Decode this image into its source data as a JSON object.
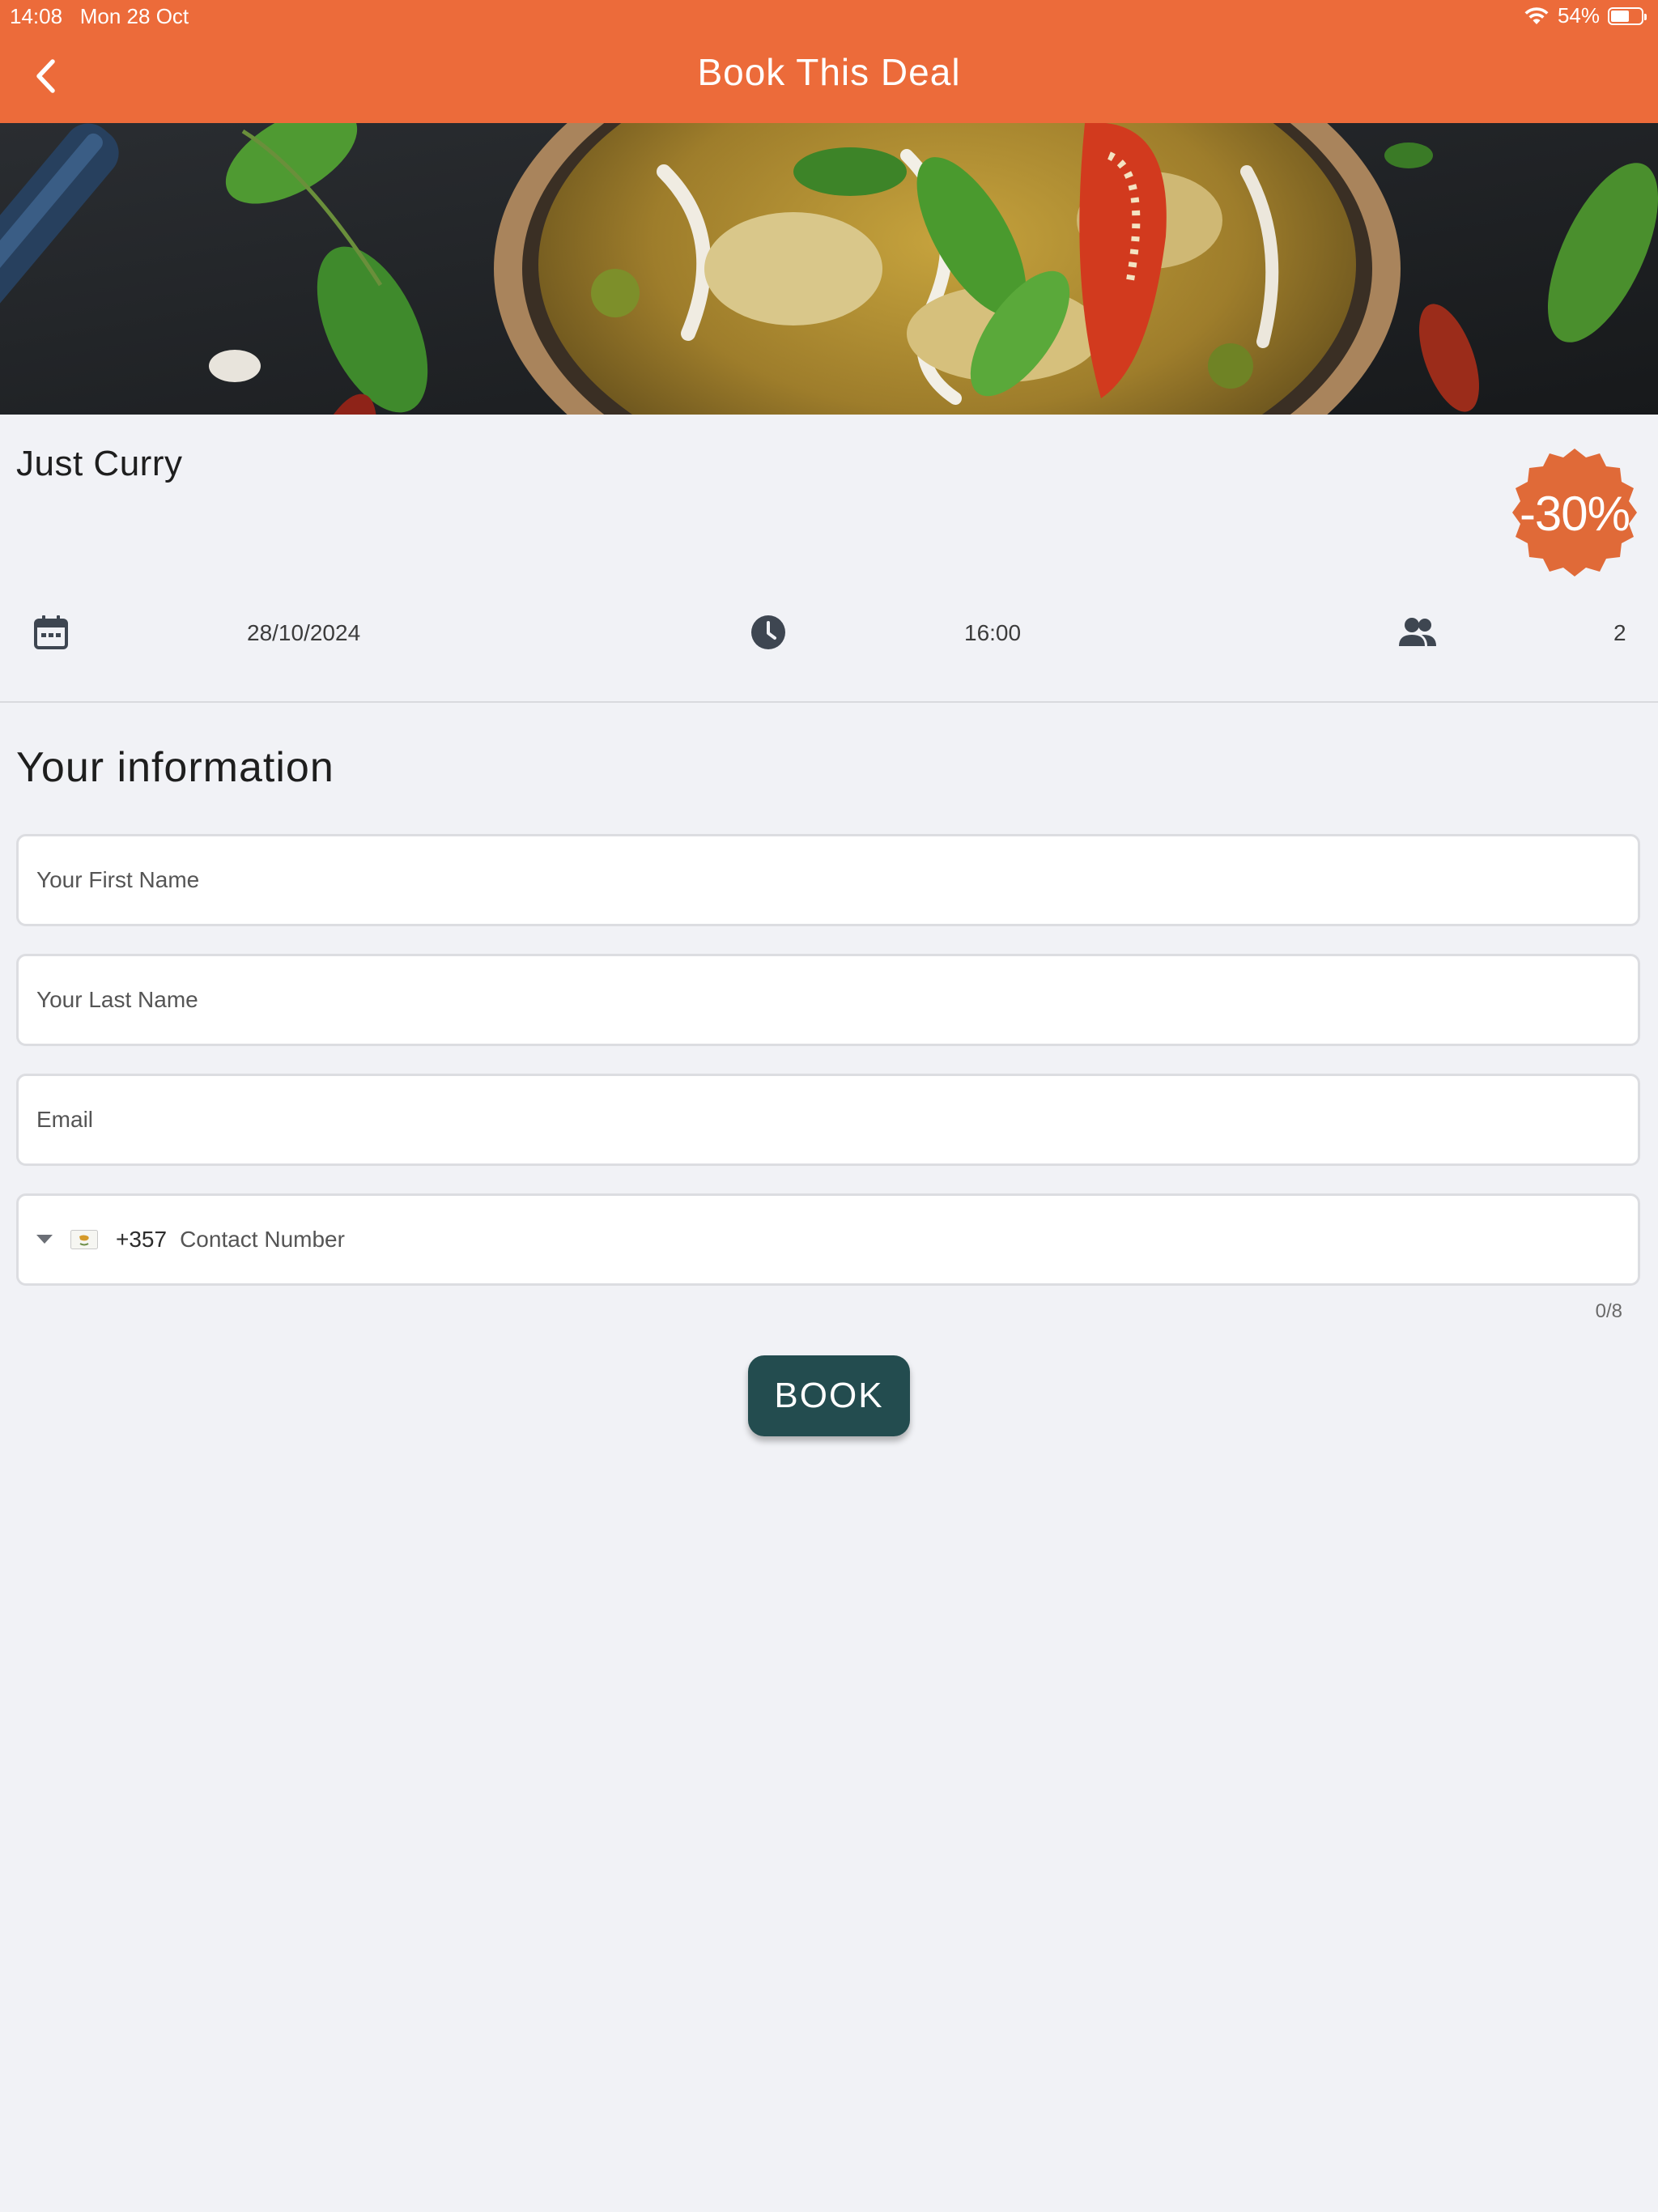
{
  "status_bar": {
    "time": "14:08",
    "date": "Mon 28 Oct",
    "battery": "54%",
    "battery_level": 0.54
  },
  "nav": {
    "title": "Book This Deal",
    "back_icon": "chevron-left-icon"
  },
  "deal": {
    "restaurant": "Just Curry",
    "discount": "-30%",
    "date": "28/10/2024",
    "time": "16:00",
    "guests": "2",
    "icons": [
      "calendar-icon",
      "clock-icon",
      "people-icon"
    ]
  },
  "form": {
    "section_title": "Your information",
    "first_name_placeholder": "Your First Name",
    "last_name_placeholder": "Your Last Name",
    "email_placeholder": "Email",
    "dial_code": "+357",
    "phone_placeholder": "Contact Number",
    "counter": "0/8",
    "book_label": "BOOK"
  },
  "colors": {
    "brand": "#ec6b3a",
    "button": "#234c4f",
    "background": "#f1f2f6"
  }
}
